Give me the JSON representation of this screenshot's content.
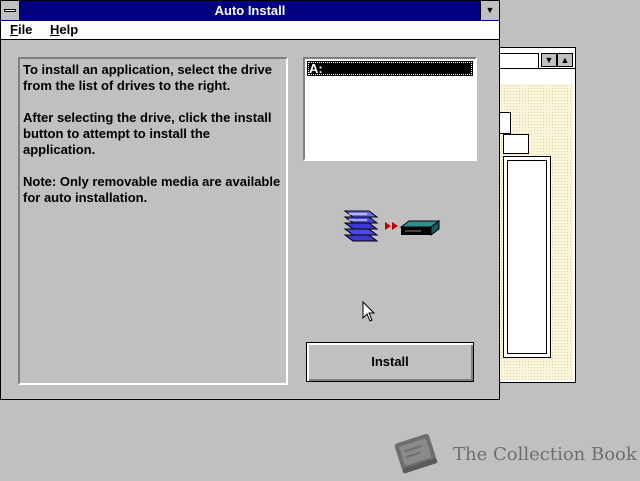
{
  "window": {
    "title": "Auto Install",
    "minimize_icon": "down-arrow-icon"
  },
  "menu": {
    "file": {
      "accel": "F",
      "rest": "ile"
    },
    "help": {
      "accel": "H",
      "rest": "elp"
    }
  },
  "instructions": {
    "para1": "To install an application, select the drive from the list of drives to the right.",
    "para2": "After selecting the drive, click the install button to attempt to install the application.",
    "para3": "Note: Only removable media are available for auto installation."
  },
  "drives": {
    "items": [
      "A:"
    ],
    "selected": "A:"
  },
  "install_button": {
    "label": "Install"
  },
  "watermark": {
    "text": "The Collection Book"
  },
  "colors": {
    "titlebar": "#000080",
    "face": "#c0c0c0",
    "selection": "#000000"
  }
}
